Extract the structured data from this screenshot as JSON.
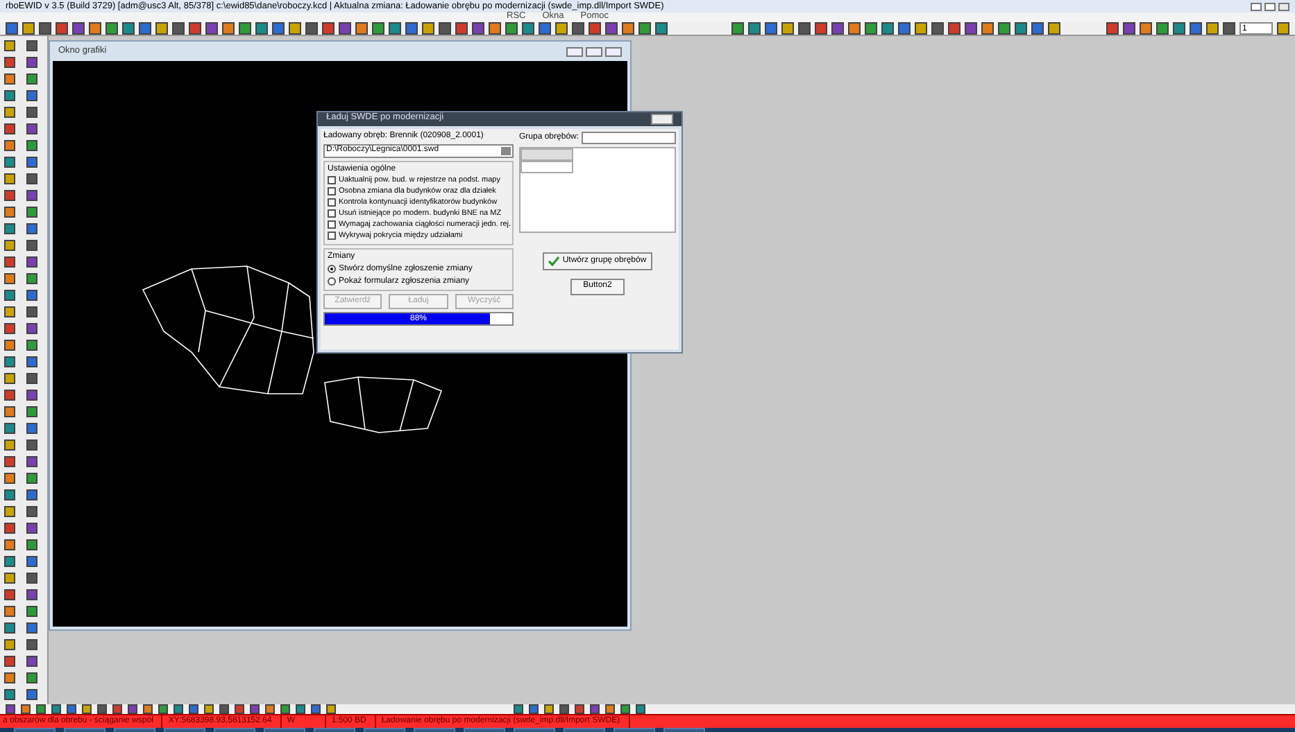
{
  "window": {
    "title": "rboEWID v 3.5 (Build 3729) [adm@usc3 Alt, 85/378] c:\\ewid85\\dane\\roboczy.kcd | Aktualna zmiana: Ładowanie obrębu po modernizacji (swde_imp.dll/Import SWDE)"
  },
  "menu": [
    {
      "label": "RSC"
    },
    {
      "label": "Okna"
    },
    {
      "label": "Pomoc"
    }
  ],
  "toolbar": {
    "scale_value": "1"
  },
  "map_window": {
    "title": "Okno grafiki"
  },
  "dialog": {
    "title": "Ładuj SWDE po modernizacji",
    "loaded_label": "Ładowany obręb: Brennik (020908_2.0001)",
    "path": "D:\\Roboczy\\Legnica\\0001.swd",
    "settings_title": "Ustawienia ogólne",
    "settings": [
      {
        "label": "Uaktualnij pow. bud. w rejestrze na podst. mapy",
        "checked": false
      },
      {
        "label": "Osobna zmiana dla budynków oraz dla działek",
        "checked": false
      },
      {
        "label": "Kontrola kontynuacji identyfikatorów budynków",
        "checked": false
      },
      {
        "label": "Usuń istniejące po modern. budynki BNE na MZ",
        "checked": false
      },
      {
        "label": "Wymagaj zachowania ciągłości numeracji jedn. rej.",
        "checked": false
      },
      {
        "label": "Wykrywaj pokrycia między udziałami",
        "checked": false
      }
    ],
    "changes_title": "Zmiany",
    "changes": [
      {
        "label": "Stwórz domyślne zgłoszenie zmiany",
        "selected": true
      },
      {
        "label": "Pokaż formularz zgłoszenia zmiany",
        "selected": false
      }
    ],
    "buttons": [
      {
        "label": "Zatwierdź",
        "disabled": true
      },
      {
        "label": "Ładuj",
        "disabled": true
      },
      {
        "label": "Wyczyść",
        "disabled": true
      }
    ],
    "progress": {
      "level": 0.88,
      "reading": "88%"
    },
    "group_label": "Grupa obrębów:",
    "create_group_button": "Utwórz grupę obrębów",
    "button2": "Button2"
  },
  "status_bar": [
    {
      "text": "a obszarów dla obrebu - ściąganie współ"
    },
    {
      "text": "XY:5683398.93,5813152.64"
    },
    {
      "text": "W"
    },
    {
      "text": "1:500 BD"
    },
    {
      "text": "Ładowanie obrębu po modernizacji (swde_imp.dll/Import SWDE)"
    }
  ]
}
